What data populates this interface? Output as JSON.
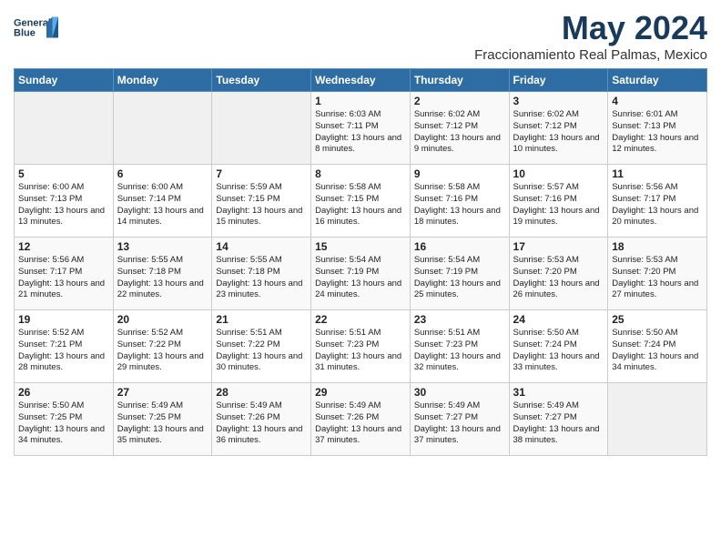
{
  "logo": {
    "line1": "General",
    "line2": "Blue"
  },
  "title": "May 2024",
  "location": "Fraccionamiento Real Palmas, Mexico",
  "days_of_week": [
    "Sunday",
    "Monday",
    "Tuesday",
    "Wednesday",
    "Thursday",
    "Friday",
    "Saturday"
  ],
  "weeks": [
    [
      {
        "day": "",
        "content": ""
      },
      {
        "day": "",
        "content": ""
      },
      {
        "day": "",
        "content": ""
      },
      {
        "day": "1",
        "content": "Sunrise: 6:03 AM\nSunset: 7:11 PM\nDaylight: 13 hours and 8 minutes."
      },
      {
        "day": "2",
        "content": "Sunrise: 6:02 AM\nSunset: 7:12 PM\nDaylight: 13 hours and 9 minutes."
      },
      {
        "day": "3",
        "content": "Sunrise: 6:02 AM\nSunset: 7:12 PM\nDaylight: 13 hours and 10 minutes."
      },
      {
        "day": "4",
        "content": "Sunrise: 6:01 AM\nSunset: 7:13 PM\nDaylight: 13 hours and 12 minutes."
      }
    ],
    [
      {
        "day": "5",
        "content": "Sunrise: 6:00 AM\nSunset: 7:13 PM\nDaylight: 13 hours and 13 minutes."
      },
      {
        "day": "6",
        "content": "Sunrise: 6:00 AM\nSunset: 7:14 PM\nDaylight: 13 hours and 14 minutes."
      },
      {
        "day": "7",
        "content": "Sunrise: 5:59 AM\nSunset: 7:15 PM\nDaylight: 13 hours and 15 minutes."
      },
      {
        "day": "8",
        "content": "Sunrise: 5:58 AM\nSunset: 7:15 PM\nDaylight: 13 hours and 16 minutes."
      },
      {
        "day": "9",
        "content": "Sunrise: 5:58 AM\nSunset: 7:16 PM\nDaylight: 13 hours and 18 minutes."
      },
      {
        "day": "10",
        "content": "Sunrise: 5:57 AM\nSunset: 7:16 PM\nDaylight: 13 hours and 19 minutes."
      },
      {
        "day": "11",
        "content": "Sunrise: 5:56 AM\nSunset: 7:17 PM\nDaylight: 13 hours and 20 minutes."
      }
    ],
    [
      {
        "day": "12",
        "content": "Sunrise: 5:56 AM\nSunset: 7:17 PM\nDaylight: 13 hours and 21 minutes."
      },
      {
        "day": "13",
        "content": "Sunrise: 5:55 AM\nSunset: 7:18 PM\nDaylight: 13 hours and 22 minutes."
      },
      {
        "day": "14",
        "content": "Sunrise: 5:55 AM\nSunset: 7:18 PM\nDaylight: 13 hours and 23 minutes."
      },
      {
        "day": "15",
        "content": "Sunrise: 5:54 AM\nSunset: 7:19 PM\nDaylight: 13 hours and 24 minutes."
      },
      {
        "day": "16",
        "content": "Sunrise: 5:54 AM\nSunset: 7:19 PM\nDaylight: 13 hours and 25 minutes."
      },
      {
        "day": "17",
        "content": "Sunrise: 5:53 AM\nSunset: 7:20 PM\nDaylight: 13 hours and 26 minutes."
      },
      {
        "day": "18",
        "content": "Sunrise: 5:53 AM\nSunset: 7:20 PM\nDaylight: 13 hours and 27 minutes."
      }
    ],
    [
      {
        "day": "19",
        "content": "Sunrise: 5:52 AM\nSunset: 7:21 PM\nDaylight: 13 hours and 28 minutes."
      },
      {
        "day": "20",
        "content": "Sunrise: 5:52 AM\nSunset: 7:22 PM\nDaylight: 13 hours and 29 minutes."
      },
      {
        "day": "21",
        "content": "Sunrise: 5:51 AM\nSunset: 7:22 PM\nDaylight: 13 hours and 30 minutes."
      },
      {
        "day": "22",
        "content": "Sunrise: 5:51 AM\nSunset: 7:23 PM\nDaylight: 13 hours and 31 minutes."
      },
      {
        "day": "23",
        "content": "Sunrise: 5:51 AM\nSunset: 7:23 PM\nDaylight: 13 hours and 32 minutes."
      },
      {
        "day": "24",
        "content": "Sunrise: 5:50 AM\nSunset: 7:24 PM\nDaylight: 13 hours and 33 minutes."
      },
      {
        "day": "25",
        "content": "Sunrise: 5:50 AM\nSunset: 7:24 PM\nDaylight: 13 hours and 34 minutes."
      }
    ],
    [
      {
        "day": "26",
        "content": "Sunrise: 5:50 AM\nSunset: 7:25 PM\nDaylight: 13 hours and 34 minutes."
      },
      {
        "day": "27",
        "content": "Sunrise: 5:49 AM\nSunset: 7:25 PM\nDaylight: 13 hours and 35 minutes."
      },
      {
        "day": "28",
        "content": "Sunrise: 5:49 AM\nSunset: 7:26 PM\nDaylight: 13 hours and 36 minutes."
      },
      {
        "day": "29",
        "content": "Sunrise: 5:49 AM\nSunset: 7:26 PM\nDaylight: 13 hours and 37 minutes."
      },
      {
        "day": "30",
        "content": "Sunrise: 5:49 AM\nSunset: 7:27 PM\nDaylight: 13 hours and 37 minutes."
      },
      {
        "day": "31",
        "content": "Sunrise: 5:49 AM\nSunset: 7:27 PM\nDaylight: 13 hours and 38 minutes."
      },
      {
        "day": "",
        "content": ""
      }
    ]
  ]
}
